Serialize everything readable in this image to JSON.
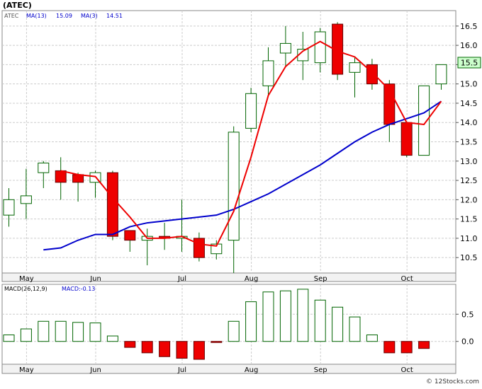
{
  "chart_data": [
    {
      "type": "candlestick",
      "title": "(ATEC)",
      "legend": [
        {
          "label": "ATEC",
          "color": "#555555"
        },
        {
          "label": "MA(13)",
          "value": "15.09",
          "color": "#0000cc"
        },
        {
          "label": "MA(3)",
          "value": "14.51",
          "color": "#0000cc"
        }
      ],
      "last_price_label": "15.5",
      "colors": {
        "up_fill": "#ffffff",
        "up_stroke": "#006400",
        "down_fill": "#ee0000",
        "down_stroke": "#660000",
        "wick": "#006400",
        "ma_red": "#ee0000",
        "ma_blue": "#0000cc",
        "grid": "#cccccc",
        "label_bg": "#ccffcc"
      },
      "ylim": [
        10.1,
        16.9
      ],
      "yticks": [
        "10.5",
        "11.0",
        "11.5",
        "12.0",
        "12.5",
        "13.0",
        "13.5",
        "14.0",
        "14.5",
        "15.0",
        "15.5",
        "16.0",
        "16.5"
      ],
      "x_labels": [
        "May",
        "Jun",
        "Jul",
        "Aug",
        "Sep",
        "Oct"
      ],
      "x_label_week_index": [
        1,
        5,
        10,
        14,
        18,
        23
      ],
      "candles": [
        {
          "o": 11.6,
          "h": 12.3,
          "l": 11.3,
          "c": 12.0
        },
        {
          "o": 11.9,
          "h": 12.8,
          "l": 11.5,
          "c": 12.1
        },
        {
          "o": 12.7,
          "h": 13.0,
          "l": 12.3,
          "c": 12.95
        },
        {
          "o": 12.75,
          "h": 13.1,
          "l": 12.0,
          "c": 12.45
        },
        {
          "o": 12.65,
          "h": 12.7,
          "l": 11.95,
          "c": 12.45
        },
        {
          "o": 12.45,
          "h": 12.75,
          "l": 12.05,
          "c": 12.7
        },
        {
          "o": 12.7,
          "h": 12.75,
          "l": 10.95,
          "c": 11.05
        },
        {
          "o": 11.2,
          "h": 11.2,
          "l": 10.65,
          "c": 10.95
        },
        {
          "o": 10.95,
          "h": 11.25,
          "l": 10.3,
          "c": 11.05
        },
        {
          "o": 11.05,
          "h": 11.4,
          "l": 10.7,
          "c": 11.0
        },
        {
          "o": 11.0,
          "h": 12.0,
          "l": 10.65,
          "c": 11.05
        },
        {
          "o": 11.0,
          "h": 11.15,
          "l": 10.4,
          "c": 10.5
        },
        {
          "o": 10.6,
          "h": 10.95,
          "l": 10.45,
          "c": 10.85
        },
        {
          "o": 10.95,
          "h": 13.9,
          "l": 10.1,
          "c": 13.75
        },
        {
          "o": 13.85,
          "h": 14.9,
          "l": 13.75,
          "c": 14.75
        },
        {
          "o": 14.95,
          "h": 15.95,
          "l": 14.7,
          "c": 15.6
        },
        {
          "o": 15.8,
          "h": 16.5,
          "l": 15.45,
          "c": 16.05
        },
        {
          "o": 15.6,
          "h": 16.35,
          "l": 15.1,
          "c": 15.9
        },
        {
          "o": 15.55,
          "h": 16.45,
          "l": 15.3,
          "c": 16.35
        },
        {
          "o": 16.55,
          "h": 16.6,
          "l": 15.1,
          "c": 15.25
        },
        {
          "o": 15.3,
          "h": 15.7,
          "l": 14.65,
          "c": 15.55
        },
        {
          "o": 15.5,
          "h": 15.65,
          "l": 14.85,
          "c": 15.0
        },
        {
          "o": 15.0,
          "h": 15.1,
          "l": 13.5,
          "c": 13.95
        },
        {
          "o": 14.0,
          "h": 14.0,
          "l": 13.1,
          "c": 13.15
        },
        {
          "o": 13.15,
          "h": 14.95,
          "l": 13.15,
          "c": 14.95
        },
        {
          "o": 15.0,
          "h": 15.5,
          "l": 14.85,
          "c": 15.5
        }
      ],
      "ma_fast": [
        null,
        null,
        null,
        12.75,
        12.65,
        12.6,
        12.05,
        11.55,
        11.0,
        11.0,
        11.05,
        10.85,
        10.8,
        11.7,
        13.1,
        14.7,
        15.45,
        15.85,
        16.1,
        15.85,
        15.7,
        15.3,
        14.85,
        14.0,
        13.95,
        14.55
      ],
      "ma_slow": [
        null,
        null,
        10.7,
        10.75,
        10.95,
        11.1,
        11.1,
        11.3,
        11.4,
        11.45,
        11.5,
        11.55,
        11.6,
        11.75,
        11.95,
        12.15,
        12.4,
        12.65,
        12.9,
        13.2,
        13.5,
        13.75,
        13.95,
        14.1,
        14.25,
        14.55
      ]
    },
    {
      "type": "bar",
      "title": "MACD(26,12,9)",
      "label": "MACD:-0.13",
      "colors": {
        "pos_fill": "#ffffff",
        "pos_stroke": "#006400",
        "neg_fill": "#ee0000",
        "neg_stroke": "#660000"
      },
      "ylim": [
        -0.42,
        1.05
      ],
      "yticks": [
        "0.5",
        "0.0"
      ],
      "x_labels": [
        "May",
        "Jun",
        "Jul",
        "Aug",
        "Sep",
        "Oct"
      ],
      "values": [
        0.12,
        0.23,
        0.37,
        0.37,
        0.35,
        0.34,
        0.1,
        -0.11,
        -0.21,
        -0.28,
        -0.31,
        -0.33,
        -0.02,
        0.37,
        0.73,
        0.91,
        0.93,
        0.96,
        0.76,
        0.63,
        0.45,
        0.12,
        -0.21,
        -0.21,
        -0.13
      ]
    }
  ],
  "credit": "© 12Stocks.com"
}
